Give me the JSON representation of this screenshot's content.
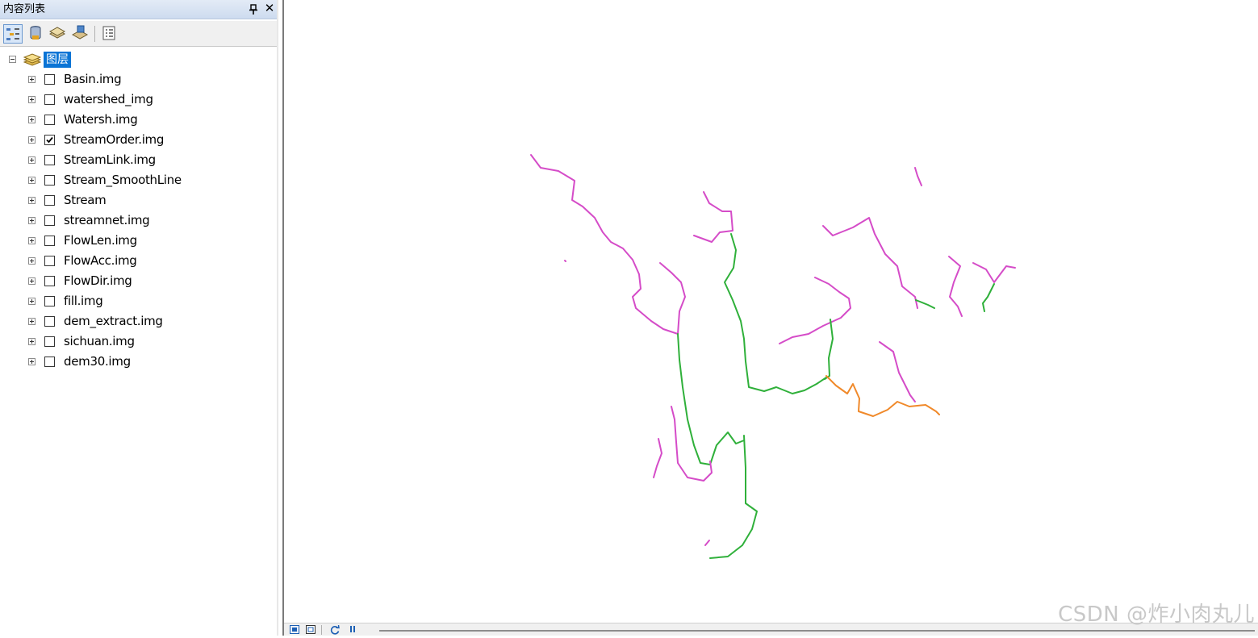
{
  "panel": {
    "title": "内容列表",
    "pin_icon": "pin-icon",
    "close_label": "✕",
    "toolbar": [
      {
        "name": "list-by-drawing-order-button",
        "icon": "drawing-order-icon",
        "active": true
      },
      {
        "name": "list-by-source-button",
        "icon": "database-source-icon",
        "active": false
      },
      {
        "name": "list-by-visibility-button",
        "icon": "layers-visibility-icon",
        "active": false
      },
      {
        "name": "list-by-selection-button",
        "icon": "selection-layers-icon",
        "active": false
      },
      {
        "name": "options-button",
        "icon": "options-list-icon",
        "active": false
      }
    ]
  },
  "group_layer": {
    "label": "图层",
    "expanded": true,
    "icon": "layers-stack-icon"
  },
  "layers": [
    {
      "label": "Basin.img",
      "checked": false
    },
    {
      "label": "watershed_img",
      "checked": false
    },
    {
      "label": "Watersh.img",
      "checked": false
    },
    {
      "label": "StreamOrder.img",
      "checked": true
    },
    {
      "label": "StreamLink.img",
      "checked": false
    },
    {
      "label": "Stream_SmoothLine",
      "checked": false
    },
    {
      "label": "Stream",
      "checked": false
    },
    {
      "label": "streamnet.img",
      "checked": false
    },
    {
      "label": "FlowLen.img",
      "checked": false
    },
    {
      "label": "FlowAcc.img",
      "checked": false
    },
    {
      "label": "FlowDir.img",
      "checked": false
    },
    {
      "label": "fill.img",
      "checked": false
    },
    {
      "label": "dem_extract.img",
      "checked": false
    },
    {
      "label": "sichuan.img",
      "checked": false
    },
    {
      "label": "dem30.img",
      "checked": false
    }
  ],
  "map": {
    "stream_colors": {
      "order1": "#d54cc8",
      "order2": "#2fb03a",
      "order3": "#f0892a"
    }
  },
  "statusbar": {
    "data_view_icon": "data-view-icon",
    "layout_view_icon": "layout-view-icon",
    "refresh_icon": "refresh-icon",
    "pause_icon": "pause-icon"
  },
  "watermark": "CSDN @炸小肉丸儿"
}
